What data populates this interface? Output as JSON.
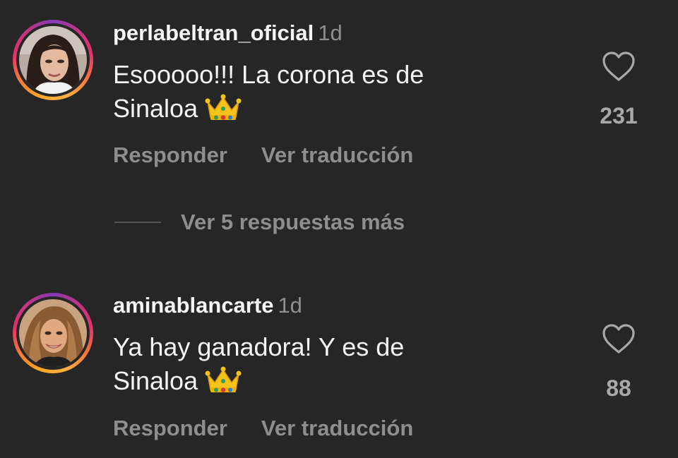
{
  "comments": [
    {
      "username": "perlabeltran_oficial",
      "time": "1d",
      "text_line1": "Esooooo!!! La corona es de",
      "text_line2": "Sinaloa",
      "emoji": "crown-emoji",
      "likes": "231",
      "reply_label": "Responder",
      "translate_label": "Ver traducción",
      "avatar_icon": "avatar-photo"
    },
    {
      "username": "aminablancarte",
      "time": "1d",
      "text_line1": "Ya hay ganadora! Y es de",
      "text_line2": "Sinaloa",
      "emoji": "crown-emoji",
      "likes": "88",
      "reply_label": "Responder",
      "translate_label": "Ver traducción",
      "avatar_icon": "avatar-photo"
    }
  ],
  "view_replies": {
    "label": "Ver 5 respuestas más"
  },
  "colors": {
    "background": "#262626",
    "primary_text": "#f5f5f5",
    "secondary_text": "#8e8e8e",
    "like_count": "#a8a8a8"
  }
}
